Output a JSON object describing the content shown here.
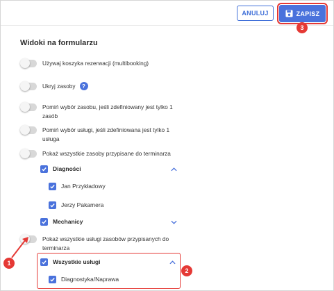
{
  "header": {
    "cancel_label": "ANULUJ",
    "save_label": "ZAPISZ"
  },
  "section": {
    "title": "Widoki na formularzu"
  },
  "toggles": [
    {
      "label": "Używaj koszyka rezerwacji (multibooking)"
    },
    {
      "label": "Ukryj zasoby"
    },
    {
      "label_line1": "Pomiń wybór zasobu, jeśli zdefiniowany jest tylko 1",
      "label_line2": "zasób"
    },
    {
      "label_line1": "Pomiń wybór usługi, jeśli zdefiniowana jest tylko 1",
      "label_line2": "usługa"
    },
    {
      "label": "Pokaż wszystkie zasoby przypisane do terminarza"
    },
    {
      "label_line1": "Pokaż wszystkie usługi zasobów przypisanych do",
      "label_line2": "terminarza"
    }
  ],
  "help_icon_text": "?",
  "groups": {
    "diagnosci": {
      "label": "Diagności",
      "items": [
        "Jan Przykładowy",
        "Jerzy Pakamera"
      ]
    },
    "mechanicy": {
      "label": "Mechanicy"
    },
    "uslugi": {
      "label": "Wszystkie usługi",
      "items": [
        "Diagnostyka/Naprawa"
      ]
    }
  },
  "annotations": {
    "badge1": "1",
    "badge2": "2",
    "badge3": "3"
  },
  "colors": {
    "accent": "#4a72dc",
    "highlight": "#e53935"
  }
}
